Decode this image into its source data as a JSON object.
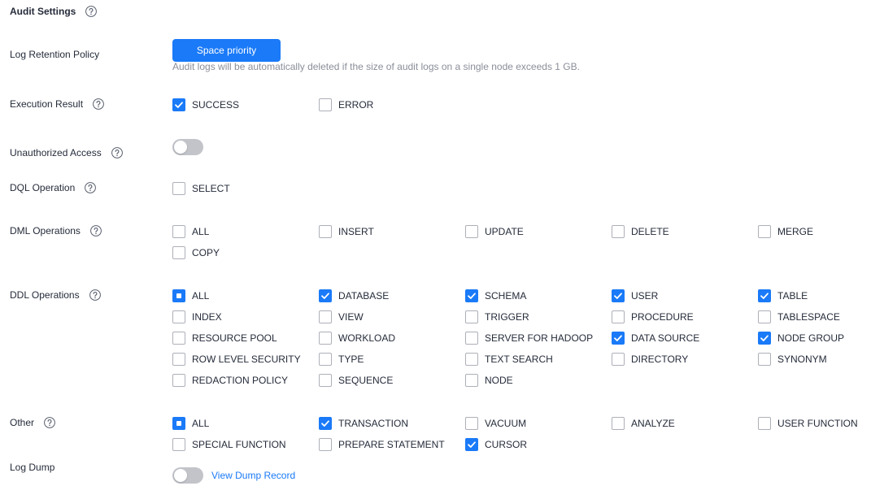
{
  "colors": {
    "primary": "#1a7af8",
    "text": "#252b3a",
    "muted": "#8a8e99",
    "checkbox_border": "#adb0b8",
    "toggle_off": "#c2c4ca",
    "icon": "#575d6c"
  },
  "icons": {
    "help": "help-circle-icon",
    "check": "check-icon"
  },
  "header": {
    "title": "Audit Settings"
  },
  "log_retention_policy": {
    "label": "Log Retention Policy",
    "button_label": "Space priority",
    "description": "Audit logs will be automatically deleted if the size of audit logs on a single node exceeds 1 GB."
  },
  "execution_result": {
    "label": "Execution Result",
    "options": [
      {
        "label": "SUCCESS",
        "checked": true
      },
      {
        "label": "ERROR",
        "checked": false
      }
    ]
  },
  "unauthorized_access": {
    "label": "Unauthorized Access",
    "enabled": false
  },
  "dql_operation": {
    "label": "DQL Operation",
    "options": [
      {
        "label": "SELECT",
        "checked": false
      }
    ]
  },
  "dml_operations": {
    "label": "DML Operations",
    "options": [
      {
        "label": "ALL",
        "checked": false
      },
      {
        "label": "INSERT",
        "checked": false
      },
      {
        "label": "UPDATE",
        "checked": false
      },
      {
        "label": "DELETE",
        "checked": false
      },
      {
        "label": "MERGE",
        "checked": false
      },
      {
        "label": "COPY",
        "checked": false
      }
    ]
  },
  "ddl_operations": {
    "label": "DDL Operations",
    "options": [
      {
        "label": "ALL",
        "checked": false,
        "indeterminate": true
      },
      {
        "label": "DATABASE",
        "checked": true
      },
      {
        "label": "SCHEMA",
        "checked": true
      },
      {
        "label": "USER",
        "checked": true
      },
      {
        "label": "TABLE",
        "checked": true
      },
      {
        "label": "INDEX",
        "checked": false
      },
      {
        "label": "VIEW",
        "checked": false
      },
      {
        "label": "TRIGGER",
        "checked": false
      },
      {
        "label": "PROCEDURE",
        "checked": false
      },
      {
        "label": "TABLESPACE",
        "checked": false
      },
      {
        "label": "RESOURCE POOL",
        "checked": false
      },
      {
        "label": "WORKLOAD",
        "checked": false
      },
      {
        "label": "SERVER FOR HADOOP",
        "checked": false
      },
      {
        "label": "DATA SOURCE",
        "checked": true
      },
      {
        "label": "NODE GROUP",
        "checked": true
      },
      {
        "label": "ROW LEVEL SECURITY",
        "checked": false
      },
      {
        "label": "TYPE",
        "checked": false
      },
      {
        "label": "TEXT SEARCH",
        "checked": false
      },
      {
        "label": "DIRECTORY",
        "checked": false
      },
      {
        "label": "SYNONYM",
        "checked": false
      },
      {
        "label": "REDACTION POLICY",
        "checked": false
      },
      {
        "label": "SEQUENCE",
        "checked": false
      },
      {
        "label": "NODE",
        "checked": false
      }
    ]
  },
  "other": {
    "label": "Other",
    "options": [
      {
        "label": "ALL",
        "checked": false,
        "indeterminate": true
      },
      {
        "label": "TRANSACTION",
        "checked": true
      },
      {
        "label": "VACUUM",
        "checked": false
      },
      {
        "label": "ANALYZE",
        "checked": false
      },
      {
        "label": "USER FUNCTION",
        "checked": false
      },
      {
        "label": "SPECIAL FUNCTION",
        "checked": false
      },
      {
        "label": "PREPARE STATEMENT",
        "checked": false
      },
      {
        "label": "CURSOR",
        "checked": true
      }
    ]
  },
  "log_dump": {
    "label": "Log Dump",
    "enabled": false,
    "link_label": "View Dump Record"
  }
}
